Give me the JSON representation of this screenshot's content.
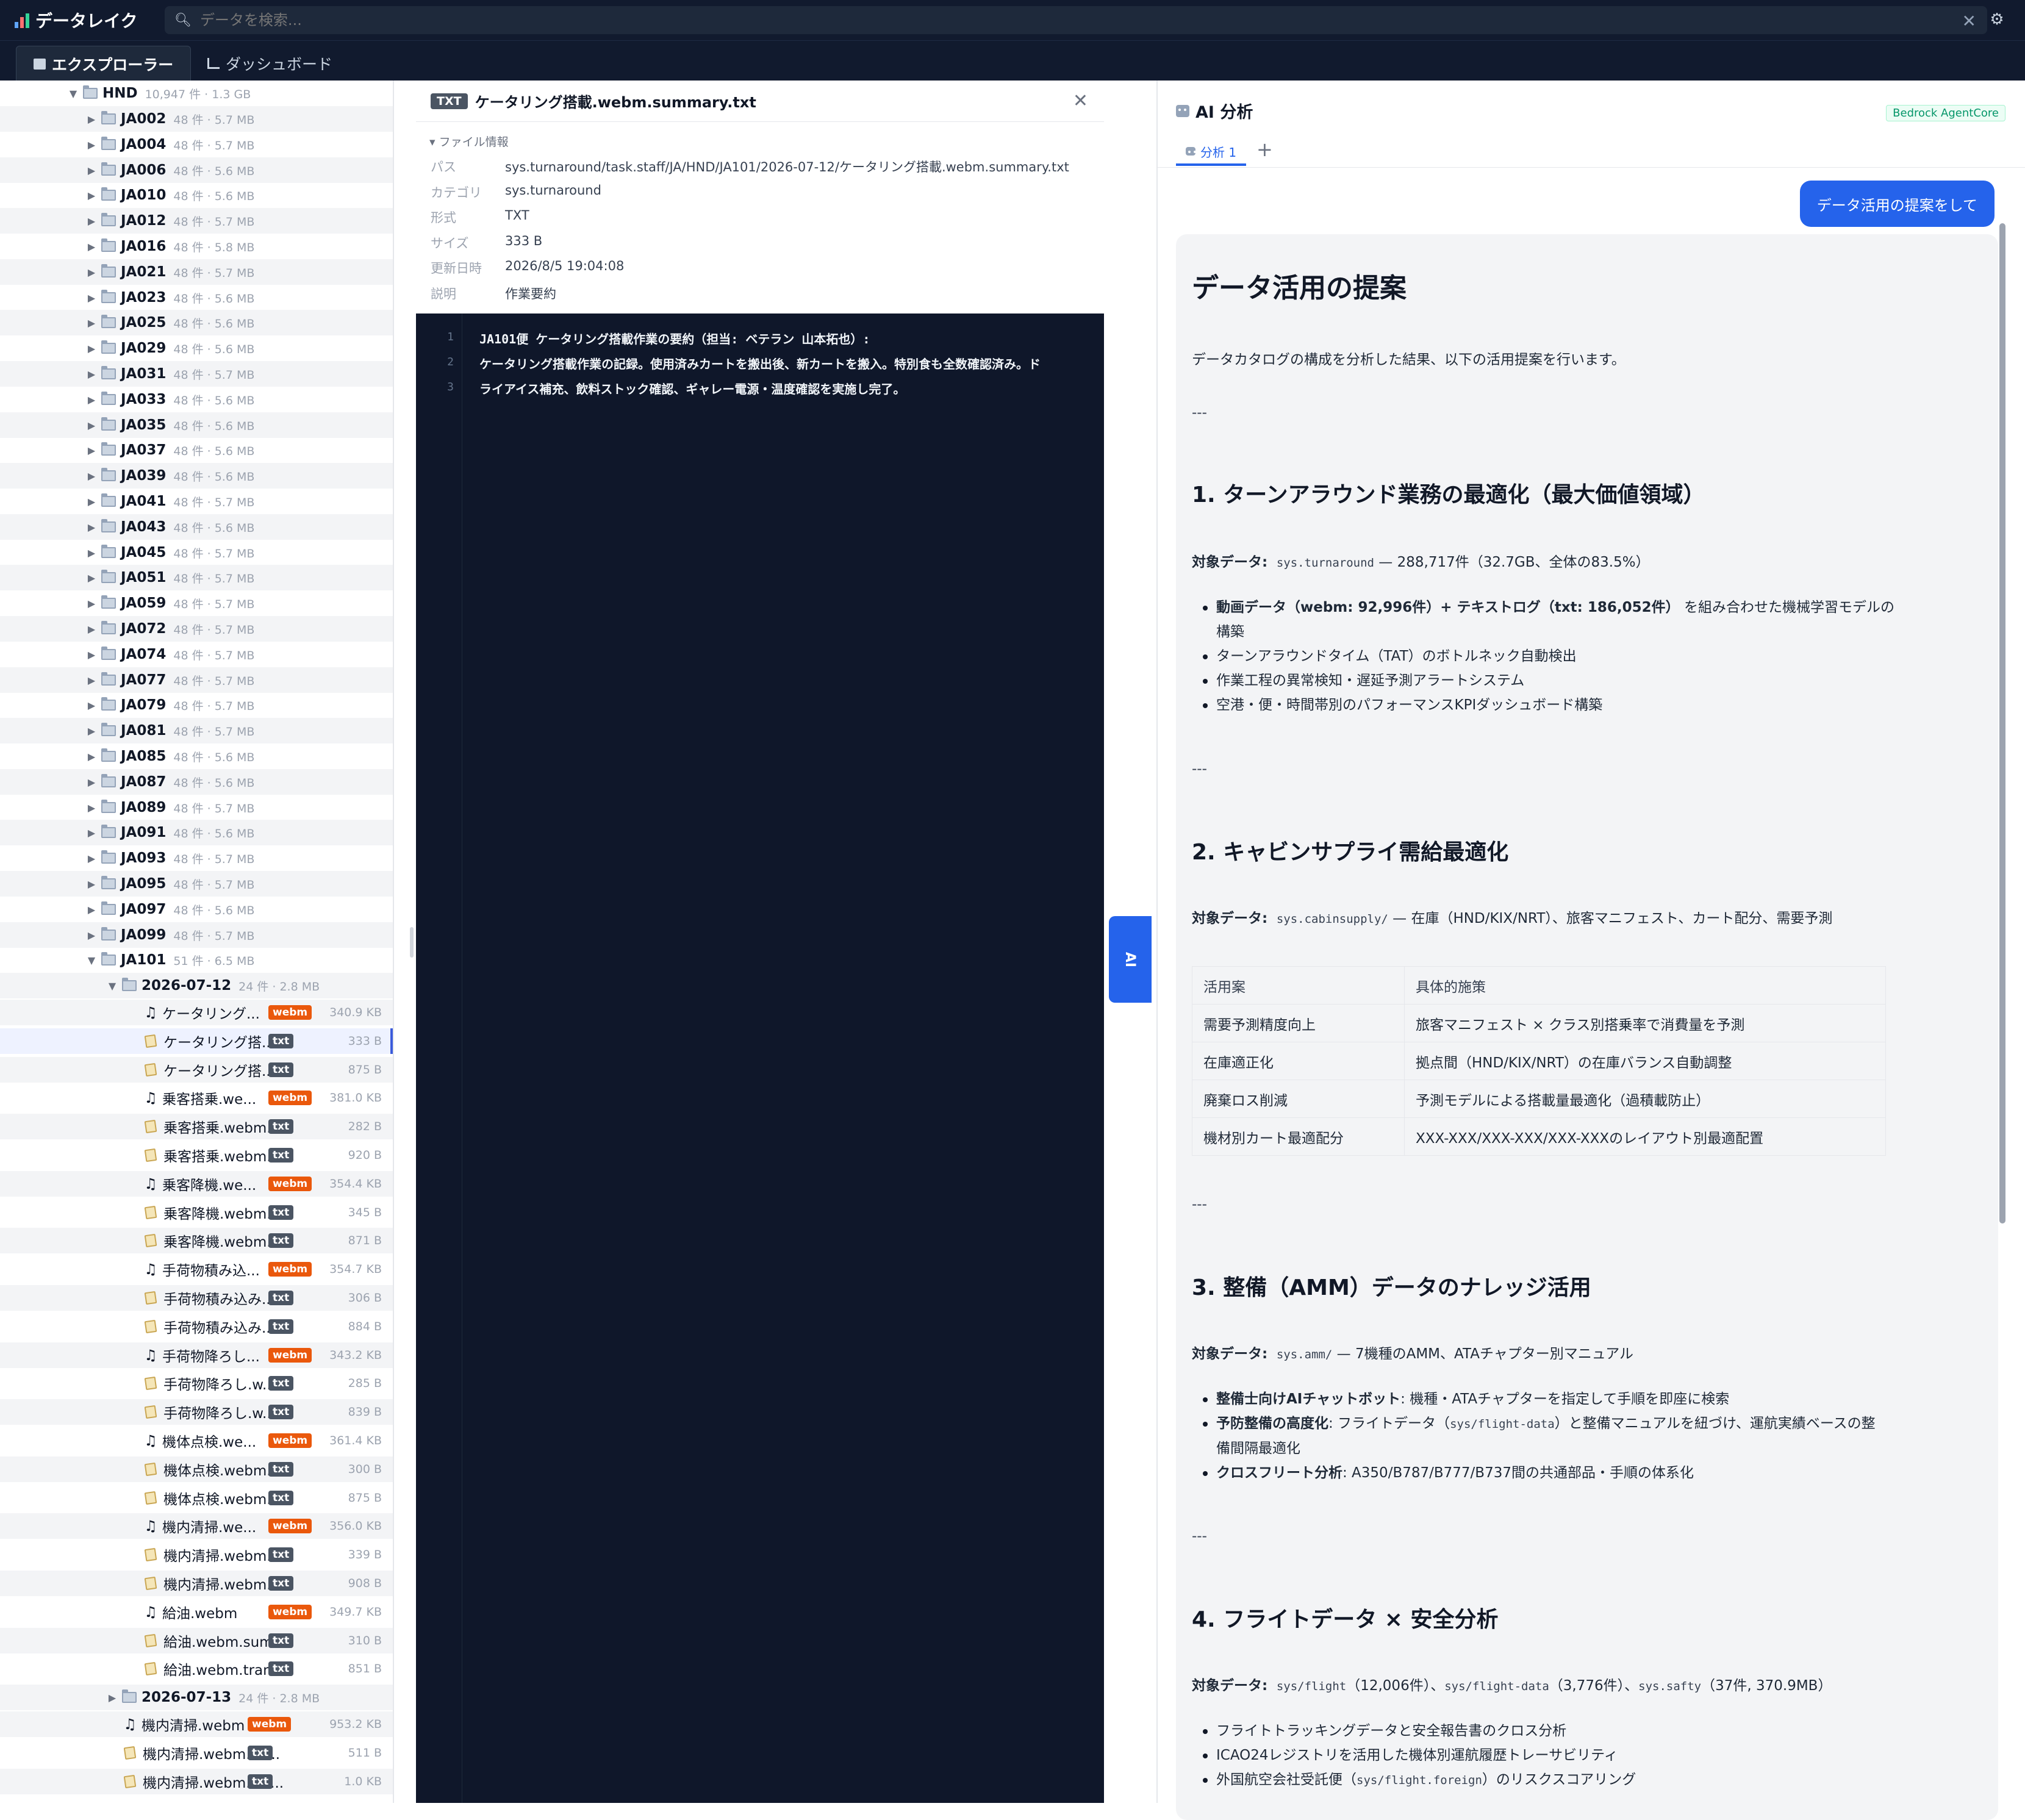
{
  "app": {
    "title": "データレイク"
  },
  "search": {
    "placeholder": "データを検索..."
  },
  "tabs": [
    {
      "label": "エクスプローラー"
    },
    {
      "label": "ダッシュボード"
    }
  ],
  "tree": {
    "root": {
      "name": "HND",
      "meta": "10,947 件 · 1.3 GB"
    },
    "folders": [
      {
        "name": "JA002",
        "meta": "48 件 · 5.7 MB"
      },
      {
        "name": "JA004",
        "meta": "48 件 · 5.7 MB"
      },
      {
        "name": "JA006",
        "meta": "48 件 · 5.6 MB"
      },
      {
        "name": "JA010",
        "meta": "48 件 · 5.6 MB"
      },
      {
        "name": "JA012",
        "meta": "48 件 · 5.7 MB"
      },
      {
        "name": "JA016",
        "meta": "48 件 · 5.8 MB"
      },
      {
        "name": "JA021",
        "meta": "48 件 · 5.7 MB"
      },
      {
        "name": "JA023",
        "meta": "48 件 · 5.6 MB"
      },
      {
        "name": "JA025",
        "meta": "48 件 · 5.6 MB"
      },
      {
        "name": "JA029",
        "meta": "48 件 · 5.6 MB"
      },
      {
        "name": "JA031",
        "meta": "48 件 · 5.7 MB"
      },
      {
        "name": "JA033",
        "meta": "48 件 · 5.6 MB"
      },
      {
        "name": "JA035",
        "meta": "48 件 · 5.6 MB"
      },
      {
        "name": "JA037",
        "meta": "48 件 · 5.6 MB"
      },
      {
        "name": "JA039",
        "meta": "48 件 · 5.6 MB"
      },
      {
        "name": "JA041",
        "meta": "48 件 · 5.7 MB"
      },
      {
        "name": "JA043",
        "meta": "48 件 · 5.6 MB"
      },
      {
        "name": "JA045",
        "meta": "48 件 · 5.7 MB"
      },
      {
        "name": "JA051",
        "meta": "48 件 · 5.7 MB"
      },
      {
        "name": "JA059",
        "meta": "48 件 · 5.7 MB"
      },
      {
        "name": "JA072",
        "meta": "48 件 · 5.7 MB"
      },
      {
        "name": "JA074",
        "meta": "48 件 · 5.7 MB"
      },
      {
        "name": "JA077",
        "meta": "48 件 · 5.7 MB"
      },
      {
        "name": "JA079",
        "meta": "48 件 · 5.7 MB"
      },
      {
        "name": "JA081",
        "meta": "48 件 · 5.7 MB"
      },
      {
        "name": "JA085",
        "meta": "48 件 · 5.6 MB"
      },
      {
        "name": "JA087",
        "meta": "48 件 · 5.6 MB"
      },
      {
        "name": "JA089",
        "meta": "48 件 · 5.7 MB"
      },
      {
        "name": "JA091",
        "meta": "48 件 · 5.6 MB"
      },
      {
        "name": "JA093",
        "meta": "48 件 · 5.7 MB"
      },
      {
        "name": "JA095",
        "meta": "48 件 · 5.7 MB"
      },
      {
        "name": "JA097",
        "meta": "48 件 · 5.6 MB"
      },
      {
        "name": "JA099",
        "meta": "48 件 · 5.7 MB"
      }
    ],
    "open_folder": {
      "name": "JA101",
      "meta": "51 件 · 6.5 MB"
    },
    "date_folder": {
      "name": "2026-07-12",
      "meta": "24 件 · 2.8 MB"
    },
    "files": [
      {
        "name": "ケータリング...",
        "type": "webm",
        "size": "340.9 KB"
      },
      {
        "name": "ケータリング搭...",
        "type": "txt",
        "size": "333 B"
      },
      {
        "name": "ケータリング搭...",
        "type": "txt",
        "size": "875 B"
      },
      {
        "name": "乗客搭乗.we...",
        "type": "webm",
        "size": "381.0 KB"
      },
      {
        "name": "乗客搭乗.webm....",
        "type": "txt",
        "size": "282 B"
      },
      {
        "name": "乗客搭乗.webm....",
        "type": "txt",
        "size": "920 B"
      },
      {
        "name": "乗客降機.we...",
        "type": "webm",
        "size": "354.4 KB"
      },
      {
        "name": "乗客降機.webm....",
        "type": "txt",
        "size": "345 B"
      },
      {
        "name": "乗客降機.webm....",
        "type": "txt",
        "size": "871 B"
      },
      {
        "name": "手荷物積み込...",
        "type": "webm",
        "size": "354.7 KB"
      },
      {
        "name": "手荷物積み込み....",
        "type": "txt",
        "size": "306 B"
      },
      {
        "name": "手荷物積み込み....",
        "type": "txt",
        "size": "884 B"
      },
      {
        "name": "手荷物降ろし...",
        "type": "webm",
        "size": "343.2 KB"
      },
      {
        "name": "手荷物降ろし.w...",
        "type": "txt",
        "size": "285 B"
      },
      {
        "name": "手荷物降ろし.w...",
        "type": "txt",
        "size": "839 B"
      },
      {
        "name": "機体点検.we...",
        "type": "webm",
        "size": "361.4 KB"
      },
      {
        "name": "機体点検.webm....",
        "type": "txt",
        "size": "300 B"
      },
      {
        "name": "機体点検.webm....",
        "type": "txt",
        "size": "875 B"
      },
      {
        "name": "機内清掃.we...",
        "type": "webm",
        "size": "356.0 KB"
      },
      {
        "name": "機内清掃.webm....",
        "type": "txt",
        "size": "339 B"
      },
      {
        "name": "機内清掃.webm....",
        "type": "txt",
        "size": "908 B"
      },
      {
        "name": "給油.webm",
        "type": "webm",
        "size": "349.7 KB"
      },
      {
        "name": "給油.webm.sum...",
        "type": "txt",
        "size": "310 B"
      },
      {
        "name": "給油.webm.tran...",
        "type": "txt",
        "size": "851 B"
      }
    ],
    "date_folder2": {
      "name": "2026-07-13",
      "meta": "24 件 · 2.8 MB"
    },
    "files2": [
      {
        "name": "機内清掃.webm",
        "type": "webm",
        "size": "953.2 KB"
      },
      {
        "name": "機内清掃.webm.su...",
        "type": "txt",
        "size": "511 B"
      },
      {
        "name": "機内清掃.webm.tra...",
        "type": "txt",
        "size": "1.0 KB"
      }
    ]
  },
  "viewer": {
    "badge": "TXT",
    "title": "ケータリング搭載.webm.summary.txt",
    "section": "ファイル情報",
    "info": [
      {
        "k": "パス",
        "v": "sys.turnaround/task.staff/JA/HND/JA101/2026-07-12/ケータリング搭載.webm.summary.txt"
      },
      {
        "k": "カテゴリ",
        "v": "sys.turnaround"
      },
      {
        "k": "形式",
        "v": "TXT"
      },
      {
        "k": "サイズ",
        "v": "333 B"
      },
      {
        "k": "更新日時",
        "v": "2026/8/5 19:04:08"
      },
      {
        "k": "説明",
        "v": "作業要約"
      }
    ],
    "lines": [
      {
        "n": "1",
        "t": "JA101便 ケータリング搭載作業の要約（担当: ベテラン 山本拓也）:"
      },
      {
        "n": "2",
        "t": "ケータリング搭載作業の記録。使用済みカートを搬出後、新カートを搬入。特別食も全数確認済み。ド"
      },
      {
        "n": "3",
        "t": "ライアイス補充、飲料ストック確認、ギャレー電源・温度確認を実施し完了。"
      }
    ]
  },
  "ai_tab_label": "AI",
  "ai": {
    "title": "AI 分析",
    "badge": "Bedrock AgentCore",
    "tab": "分析 1",
    "add": "+",
    "user_message": "データ活用の提案をして",
    "answer": {
      "h1": "データ活用の提案",
      "intro": "データカタログの構成を分析した結果、以下の活用提案を行います。",
      "hr": "---",
      "s1": {
        "title": "1. ターンアラウンド業務の最適化（最大価値領域）",
        "label": "対象データ",
        "code": "sys.turnaround",
        "rest": "— 288,717件（32.7GB、全体の83.5%）",
        "b1_bold": "動画データ（webm: 92,996件）+ テキストログ（txt: 186,052件）",
        "b1_rest": "を組み合わせた機械学習モデルの",
        "b1_cont": "構築",
        "b2": "ターンアラウンドタイム（TAT）のボトルネック自動検出",
        "b3": "作業工程の異常検知・遅延予測アラートシステム",
        "b4": "空港・便・時間帯別のパフォーマンスKPIダッシュボード構築"
      },
      "s2": {
        "title": "2. キャビンサプライ需給最適化",
        "label": "対象データ",
        "code": "sys.cabinsupply/",
        "rest": "— 在庫（HND/KIX/NRT）、旅客マニフェスト、カート配分、需要予測",
        "table": {
          "head": [
            "活用案",
            "具体的施策"
          ],
          "rows": [
            [
              "需要予測精度向上",
              "旅客マニフェスト × クラス別搭乗率で消費量を予測"
            ],
            [
              "在庫適正化",
              "拠点間（HND/KIX/NRT）の在庫バランス自動調整"
            ],
            [
              "廃棄ロス削減",
              "予測モデルによる搭載量最適化（過積載防止）"
            ],
            [
              "機材別カート最適配分",
              "XXX-XXX/XXX-XXX/XXX-XXXのレイアウト別最適配置"
            ]
          ]
        }
      },
      "s3": {
        "title": "3. 整備（AMM）データのナレッジ活用",
        "label": "対象データ",
        "code": "sys.amm/",
        "rest": "— 7機種のAMM、ATAチャプター別マニュアル",
        "b1_bold": "整備士向けAIチャットボット",
        "b1_rest": ": 機種・ATAチャプターを指定して手順を即座に検索",
        "b2_bold": "予防整備の高度化",
        "b2_rest_a": ": フライトデータ（",
        "b2_code": "sys/flight-data",
        "b2_rest_b": "）と整備マニュアルを紐づけ、運航実績ベースの整",
        "b2_cont": "備間隔最適化",
        "b3_bold": "クロスフリート分析",
        "b3_rest": ": A350/B787/B777/B737間の共通部品・手順の体系化"
      },
      "s4": {
        "title": "4. フライトデータ × 安全分析",
        "label": "対象データ",
        "code1": "sys/flight",
        "t1": "（12,006件）、",
        "code2": "sys/flight-data",
        "t2": "（3,776件）、",
        "code3": "sys.safty",
        "t3": "（37件, 370.9MB）",
        "b1": "フライトトラッキングデータと安全報告書のクロス分析",
        "b2": "ICAO24レジストリを活用した機体別運航履歴トレーサビリティ",
        "b3_a": "外国航空会社受託便（",
        "b3_code": "sys/flight.foreign",
        "b3_b": "）のリスクスコアリング"
      }
    }
  },
  "colors": {
    "accent": "#2563eb",
    "webm_badge": "#ea580c",
    "txt_badge": "#4b5563",
    "header_bg": "#111a2e",
    "code_bg": "#0f172a"
  }
}
